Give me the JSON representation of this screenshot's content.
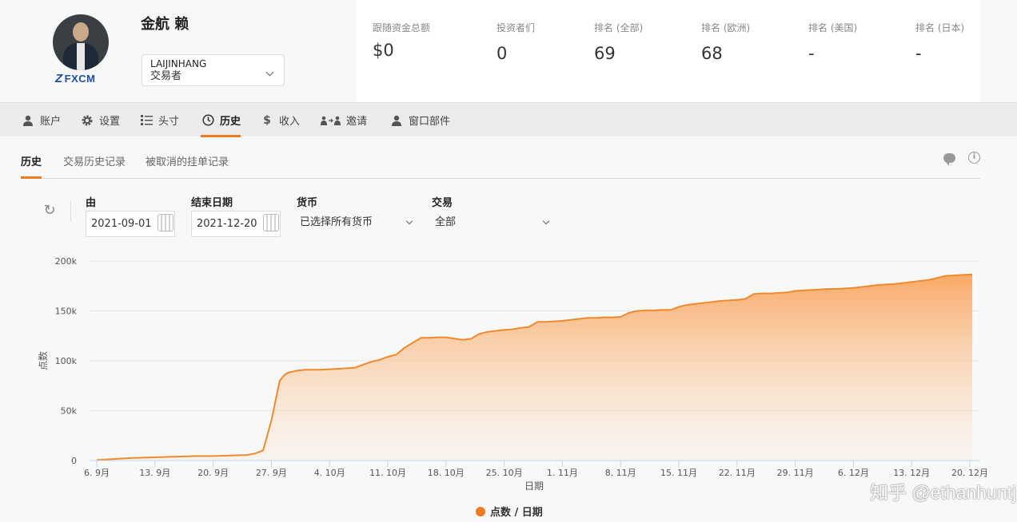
{
  "profile": {
    "name": "金航 赖",
    "broker": "FXCM",
    "account_id": "LAIJINHANG",
    "account_role": "交易者"
  },
  "stats": [
    {
      "label": "跟随资金总额",
      "value": "$0"
    },
    {
      "label": "投资者们",
      "value": "0"
    },
    {
      "label": "排名 (全部)",
      "value": "69"
    },
    {
      "label": "排名 (欧洲)",
      "value": "68"
    },
    {
      "label": "排名 (美国)",
      "value": "-"
    },
    {
      "label": "排名 (日本)",
      "value": "-"
    }
  ],
  "nav": [
    {
      "label": "账户",
      "icon": "user-icon"
    },
    {
      "label": "设置",
      "icon": "gear-icon"
    },
    {
      "label": "头寸",
      "icon": "list-icon"
    },
    {
      "label": "历史",
      "icon": "clock-icon",
      "active": true
    },
    {
      "label": "收入",
      "icon": "dollar-icon"
    },
    {
      "label": "邀请",
      "icon": "invite-icon"
    },
    {
      "label": "窗口部件",
      "icon": "widget-icon"
    }
  ],
  "subtabs": {
    "history": "历史",
    "trade_history": "交易历史记录",
    "cancelled_orders": "被取消的挂单记录"
  },
  "filters": {
    "from_label": "由",
    "from_value": "2021-09-01",
    "to_label": "结束日期",
    "to_value": "2021-12-20",
    "currency_label": "货币",
    "currency_value": "已选择所有货币",
    "trade_label": "交易",
    "trade_value": "全部"
  },
  "colors": {
    "accent": "#f07a20",
    "line": "#f08a2c"
  },
  "chart_data": {
    "type": "area",
    "xlabel": "日期",
    "ylabel": "点数",
    "legend": "点数 / 日期",
    "legend_position": "bottom",
    "grid": true,
    "ylim": [
      0,
      200000
    ],
    "yticks": [
      0,
      50000,
      100000,
      150000,
      200000
    ],
    "ytick_labels": [
      "0",
      "50k",
      "100k",
      "150k",
      "200k"
    ],
    "xlim": [
      6,
      111
    ],
    "xticks": [
      6,
      13,
      20,
      27,
      34,
      41,
      48,
      55,
      62,
      69,
      76,
      83,
      90,
      97,
      104,
      111
    ],
    "xtick_labels": [
      "6. 9月",
      "13. 9月",
      "20. 9月",
      "27. 9月",
      "4. 10月",
      "11. 10月",
      "18. 10月",
      "25. 10月",
      "1. 11月",
      "8. 11月",
      "15. 11月",
      "22. 11月",
      "29. 11月",
      "6. 12月",
      "13. 12月",
      "20. 12月"
    ],
    "x": [
      6,
      8,
      10,
      12,
      14,
      16,
      18,
      20,
      22,
      24,
      25,
      26,
      27,
      28,
      28.6,
      29,
      29.5,
      30,
      31,
      33,
      35,
      37,
      38,
      39,
      40,
      41,
      42,
      43,
      44,
      45,
      46,
      47,
      48,
      50,
      51,
      52,
      53,
      54,
      55,
      56,
      57,
      58,
      59,
      60,
      61,
      62,
      63,
      64,
      65,
      66,
      67,
      68,
      69,
      70,
      71,
      72,
      73,
      74,
      75,
      76,
      77,
      78,
      79,
      80,
      81,
      82,
      83,
      84,
      85,
      86,
      87,
      88,
      89,
      90,
      91,
      92,
      93,
      94,
      95,
      96,
      97,
      98,
      99,
      100,
      101,
      102,
      103,
      104,
      105,
      106,
      107,
      108,
      109,
      110,
      111.3
    ],
    "y": [
      500,
      1500,
      2500,
      3000,
      3500,
      4000,
      4500,
      4500,
      5000,
      5500,
      7000,
      10000,
      40000,
      80000,
      86000,
      88000,
      89000,
      90000,
      91000,
      91000,
      92000,
      93000,
      96000,
      99000,
      101000,
      104000,
      106000,
      113000,
      118000,
      123000,
      123000,
      123500,
      123500,
      121000,
      122000,
      127000,
      129000,
      130000,
      131000,
      131500,
      133000,
      134000,
      139000,
      139000,
      139500,
      140000,
      141000,
      142000,
      143000,
      143000,
      143500,
      143500,
      144000,
      148000,
      150000,
      150500,
      150500,
      151000,
      151000,
      154000,
      156000,
      157000,
      158000,
      159000,
      160000,
      160500,
      161000,
      162000,
      167000,
      167500,
      167500,
      168000,
      168500,
      170000,
      170500,
      171000,
      171500,
      172000,
      172000,
      172500,
      173000,
      174000,
      175000,
      176000,
      176500,
      177000,
      178000,
      179000,
      180000,
      181000,
      183000,
      185000,
      185500,
      186000,
      186500
    ]
  },
  "watermark": "知乎 @ethanhuntj"
}
